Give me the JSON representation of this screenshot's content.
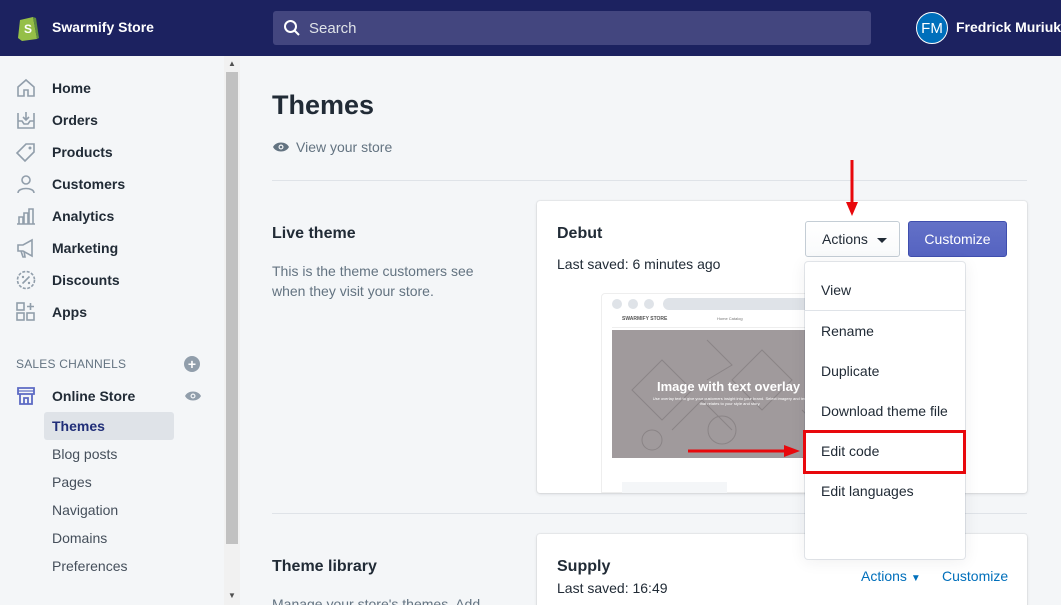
{
  "topbar": {
    "store_name": "Swarmify Store",
    "search_placeholder": "Search",
    "user_initials": "FM",
    "user_name": "Fredrick Muriuki"
  },
  "sidebar": {
    "items": [
      {
        "label": "Home",
        "icon": "home-icon"
      },
      {
        "label": "Orders",
        "icon": "orders-icon"
      },
      {
        "label": "Products",
        "icon": "tag-icon"
      },
      {
        "label": "Customers",
        "icon": "person-icon"
      },
      {
        "label": "Analytics",
        "icon": "bar-chart-icon"
      },
      {
        "label": "Marketing",
        "icon": "megaphone-icon"
      },
      {
        "label": "Discounts",
        "icon": "discount-icon"
      },
      {
        "label": "Apps",
        "icon": "apps-icon"
      }
    ],
    "sales_channels_title": "SALES CHANNELS",
    "online_store_label": "Online Store",
    "sub_items": [
      {
        "label": "Themes",
        "active": true
      },
      {
        "label": "Blog posts",
        "active": false
      },
      {
        "label": "Pages",
        "active": false
      },
      {
        "label": "Navigation",
        "active": false
      },
      {
        "label": "Domains",
        "active": false
      },
      {
        "label": "Preferences",
        "active": false
      }
    ]
  },
  "main": {
    "title": "Themes",
    "view_store": "View your store",
    "live_theme": {
      "heading": "Live theme",
      "description": "This is the theme customers see when they visit your store.",
      "card_title": "Debut",
      "last_saved": "Last saved: 6 minutes ago",
      "actions_label": "Actions",
      "customize_label": "Customize"
    },
    "preview": {
      "store_name": "SWARMIFY STORE",
      "nav": "Home   Catalog",
      "hero_title": "Image with text overlay",
      "hero_text": "Use overlay text to give your customers insight into your brand. Select imagery and text that relates to your style and story."
    },
    "actions_menu": [
      "View",
      "Rename",
      "Duplicate",
      "Download theme file",
      "Edit code",
      "Edit languages"
    ],
    "theme_library": {
      "heading": "Theme library",
      "description": "Manage your store's themes. Add",
      "card_title": "Supply",
      "last_saved": "Last saved: 16:49",
      "actions_label": "Actions",
      "customize_label": "Customize"
    }
  },
  "colors": {
    "topbar_bg": "#1c2260",
    "primary_button": "#5c6ac4",
    "link": "#006fbb",
    "annotation_red": "#e8080c"
  }
}
